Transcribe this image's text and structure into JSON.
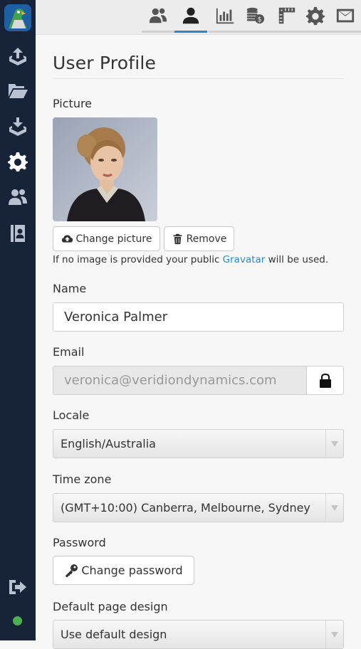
{
  "topbar": {
    "tabs": [
      {
        "icon": "users-icon",
        "active": false
      },
      {
        "icon": "user-icon",
        "active": true
      },
      {
        "icon": "bar-chart-icon",
        "active": false
      },
      {
        "icon": "coins-icon",
        "active": false
      },
      {
        "icon": "ruler-icon",
        "active": false
      },
      {
        "icon": "gear-icon",
        "active": false
      },
      {
        "icon": "envelope-icon",
        "active": false
      }
    ]
  },
  "sidebar": {
    "items": [
      {
        "icon": "upload-tray-icon"
      },
      {
        "icon": "folder-open-icon"
      },
      {
        "icon": "download-tray-icon"
      },
      {
        "icon": "gear-icon",
        "active": true
      },
      {
        "icon": "users-icon"
      },
      {
        "icon": "contacts-book-icon"
      }
    ],
    "bottom": {
      "icon": "sign-out-icon",
      "status_color": "#4caf50"
    }
  },
  "profile": {
    "title": "User Profile",
    "picture_label": "Picture",
    "change_picture": "Change picture",
    "remove": "Remove",
    "hint_prefix": "If no image is provided your public ",
    "hint_link": "Gravatar",
    "hint_suffix": " will be used.",
    "name_label": "Name",
    "name_value": "Veronica Palmer",
    "email_label": "Email",
    "email_value": "veronica@veridiondynamics.com",
    "locale_label": "Locale",
    "locale_value": "English/Australia",
    "timezone_label": "Time zone",
    "timezone_value": "(GMT+10:00) Canberra, Melbourne, Sydney",
    "password_label": "Password",
    "change_password": "Change password",
    "design_label": "Default page design",
    "design_value": "Use default design"
  },
  "colors": {
    "sidebar_bg": "#172339",
    "accent": "#2f86c9",
    "link": "#2f86c9",
    "status_online": "#4caf50"
  }
}
